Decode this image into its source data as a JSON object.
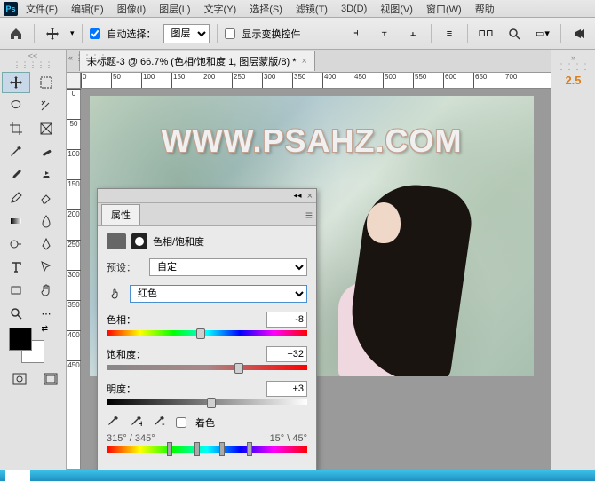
{
  "menu": {
    "file": "文件(F)",
    "edit": "编辑(E)",
    "image": "图像(I)",
    "layer": "图层(L)",
    "text": "文字(Y)",
    "select": "选择(S)",
    "filter": "滤镜(T)",
    "3d": "3D(D)",
    "view": "视图(V)",
    "window": "窗口(W)",
    "help": "帮助"
  },
  "options": {
    "auto_select": "自动选择：",
    "layer_mode": "图层",
    "show_transform": "显示变换控件"
  },
  "document": {
    "tab_title": "未标题-3 @ 66.7% (色相/饱和度 1, 图层蒙版/8) *",
    "zoom": "66.67"
  },
  "watermark": "WWW.PSAHZ.COM",
  "right": {
    "value": "2.5"
  },
  "ruler": {
    "ticks": [
      "0",
      "50",
      "100",
      "150",
      "200",
      "250",
      "300",
      "350",
      "400",
      "450",
      "500",
      "550",
      "600",
      "650",
      "700"
    ],
    "vticks": [
      "0",
      "50",
      "100",
      "150",
      "200",
      "250",
      "300",
      "350",
      "400",
      "450"
    ]
  },
  "panel": {
    "title": "属性",
    "adj_type": "色相/饱和度",
    "preset_label": "预设：",
    "preset_value": "自定",
    "range_value": "红色",
    "hue_label": "色相：",
    "hue_value": "-8",
    "sat_label": "饱和度：",
    "sat_value": "+32",
    "lig_label": "明度：",
    "lig_value": "+3",
    "colorize": "着色",
    "range_left": "315° / 345°",
    "range_right": "15° \\ 45°"
  }
}
